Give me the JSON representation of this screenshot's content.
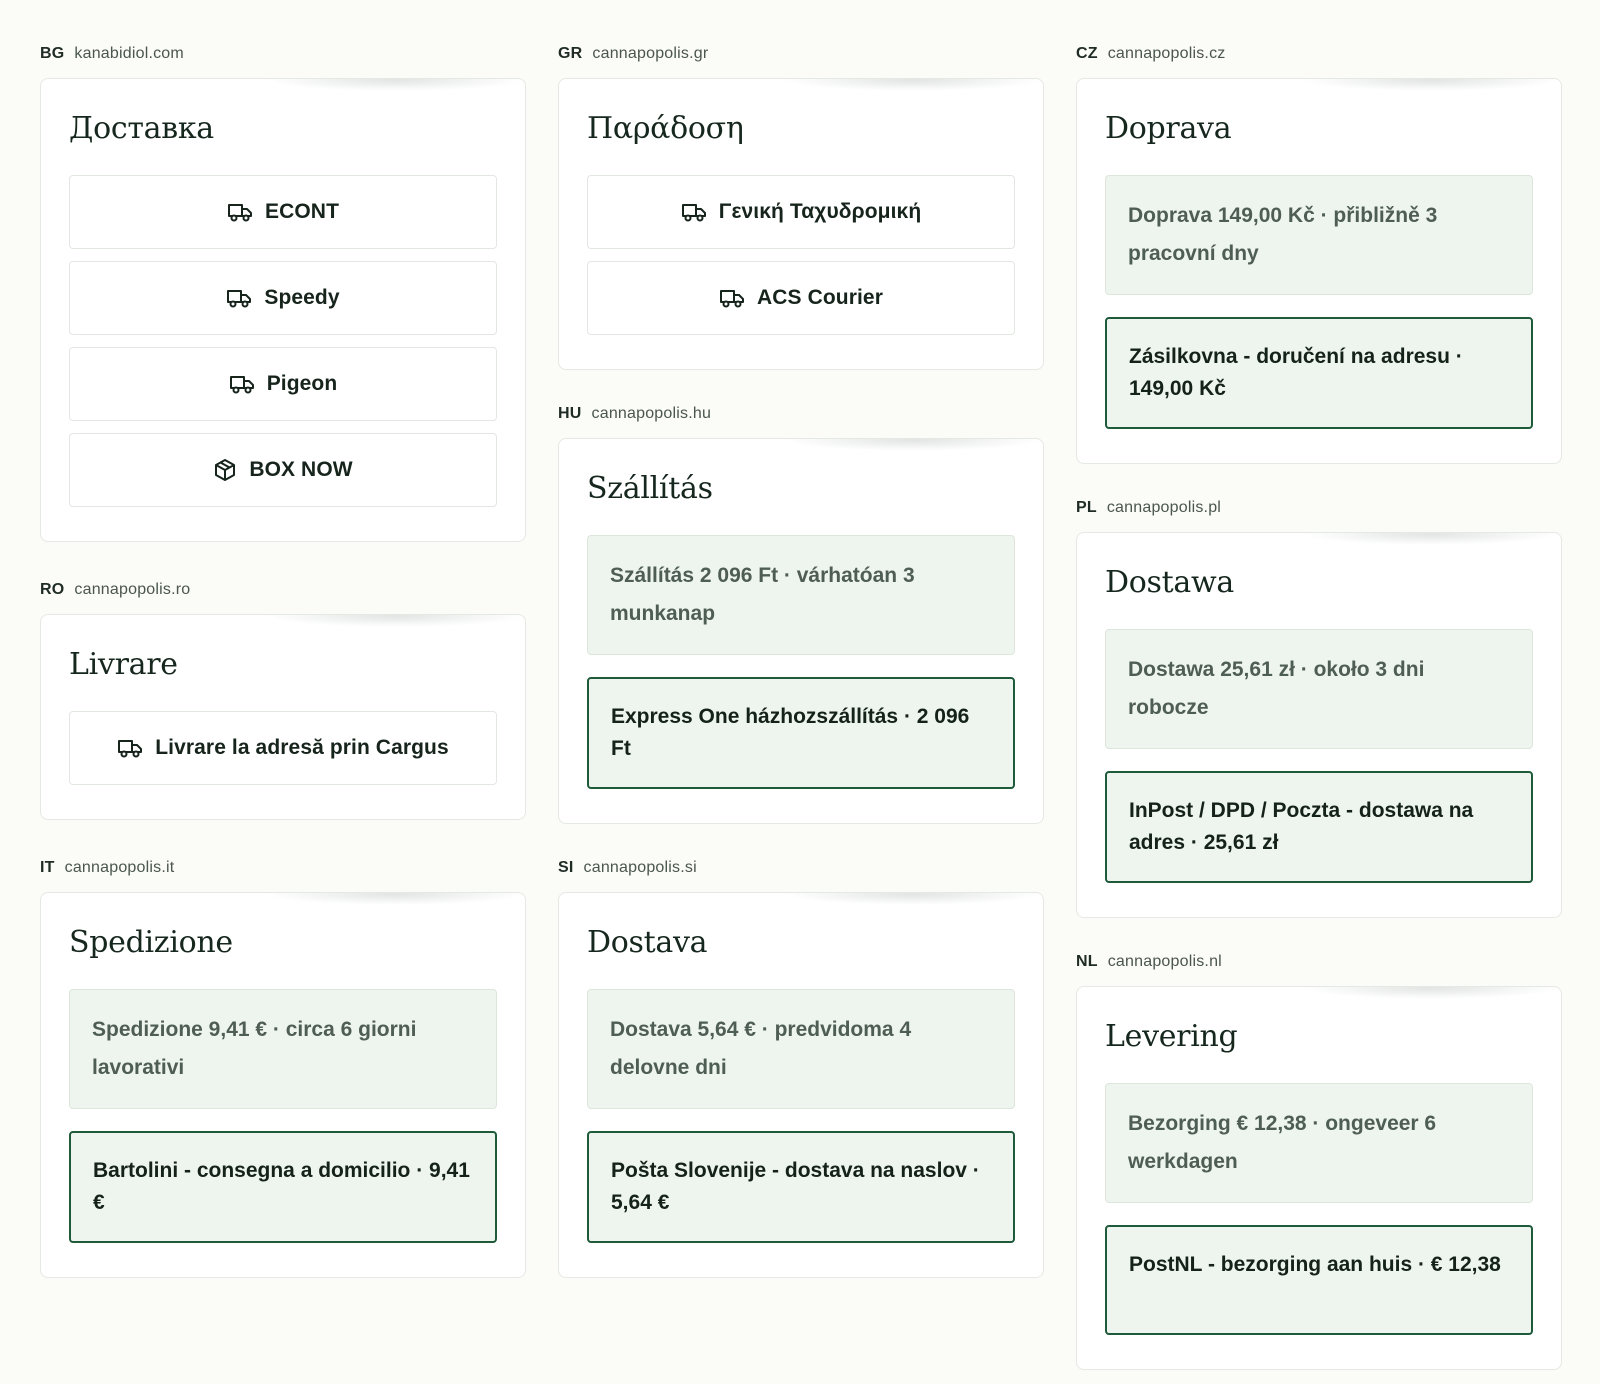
{
  "sites": {
    "bg": {
      "code": "BG",
      "domain": "kanabidiol.com",
      "title": "Доставка",
      "options": [
        {
          "label": "ECONT",
          "icon": "truck-icon"
        },
        {
          "label": "Speedy",
          "icon": "truck-icon"
        },
        {
          "label": "Pigeon",
          "icon": "truck-icon"
        },
        {
          "label": "BOX NOW",
          "icon": "package-icon"
        }
      ]
    },
    "ro": {
      "code": "RO",
      "domain": "cannapopolis.ro",
      "title": "Livrare",
      "options": [
        {
          "label": "Livrare la adresă prin Cargus",
          "icon": "truck-icon"
        }
      ]
    },
    "it": {
      "code": "IT",
      "domain": "cannapopolis.it",
      "title": "Spedizione",
      "info": "Spedizione 9,41 € · circa 6 giorni lavorativi",
      "selected": "Bartolini - consegna a domicilio · 9,41 €"
    },
    "gr": {
      "code": "GR",
      "domain": "cannapopolis.gr",
      "title": "Παράδοση",
      "options": [
        {
          "label": "Γενική Ταχυδρομική",
          "icon": "truck-icon"
        },
        {
          "label": "ACS Courier",
          "icon": "truck-icon"
        }
      ]
    },
    "hu": {
      "code": "HU",
      "domain": "cannapopolis.hu",
      "title": "Szállítás",
      "info": "Szállítás 2 096 Ft · várhatóan 3 munkanap",
      "selected": "Express One házhozszállítás · 2 096 Ft"
    },
    "si": {
      "code": "SI",
      "domain": "cannapopolis.si",
      "title": "Dostava",
      "info": "Dostava 5,64 € · predvidoma 4 delovne dni",
      "selected": "Pošta Slovenije - dostava na naslov · 5,64 €"
    },
    "cz": {
      "code": "CZ",
      "domain": "cannapopolis.cz",
      "title": "Doprava",
      "info": "Doprava 149,00 Kč · přibližně 3 pracovní dny",
      "selected": "Zásilkovna - doručení na adresu · 149,00 Kč"
    },
    "pl": {
      "code": "PL",
      "domain": "cannapopolis.pl",
      "title": "Dostawa",
      "info": "Dostawa 25,61 zł · około 3 dni robocze",
      "selected": "InPost / DPD / Poczta - dostawa na adres · 25,61 zł"
    },
    "nl": {
      "code": "NL",
      "domain": "cannapopolis.nl",
      "title": "Levering",
      "info": "Bezorging € 12,38 · ongeveer 6 werkdagen",
      "selected": "PostNL - bezorging aan huis · € 12,38"
    }
  },
  "colors": {
    "background": "#fbfbf7",
    "card": "#ffffff",
    "info_fill": "#eef4ee",
    "selected_border": "#1f5a3a",
    "muted_text": "#4f5e55"
  }
}
